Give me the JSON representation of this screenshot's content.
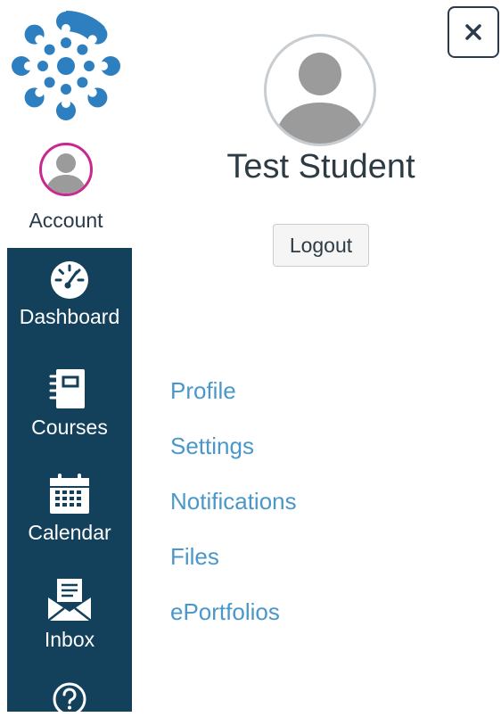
{
  "account": {
    "label": "Account"
  },
  "nav": {
    "dashboard": "Dashboard",
    "courses": "Courses",
    "calendar": "Calendar",
    "inbox": "Inbox"
  },
  "tray": {
    "user_name": "Test Student",
    "logout_label": "Logout",
    "close_icon": "close-icon",
    "links": [
      "Profile",
      "Settings",
      "Notifications",
      "Files",
      "ePortfolios"
    ]
  },
  "colors": {
    "sidebar": "#13405a",
    "link": "#4a97c9",
    "account_ring": "#c8288f",
    "logo": "#2d7fbf"
  }
}
